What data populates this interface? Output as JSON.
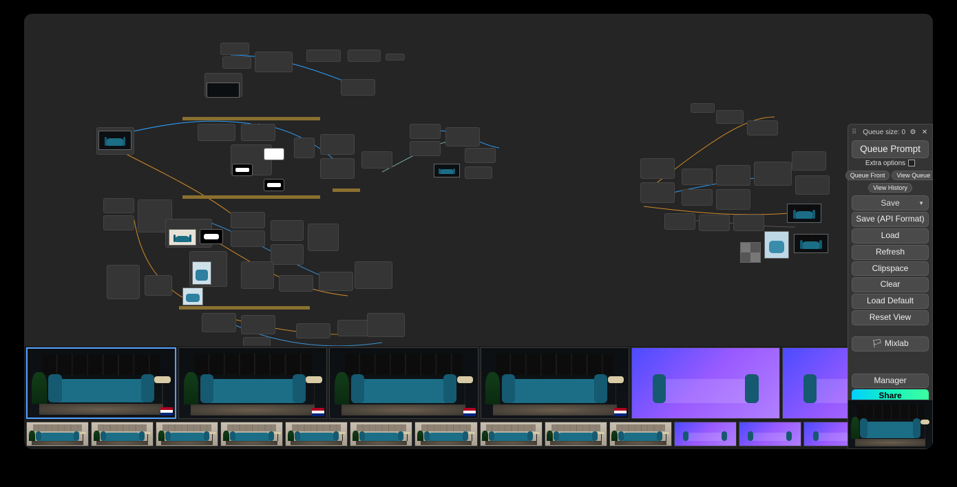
{
  "panel": {
    "queue_label": "Queue size:",
    "queue_value": "0",
    "queue_prompt": "Queue Prompt",
    "extra_options": "Extra options",
    "queue_front": "Queue Front",
    "view_queue": "View Queue",
    "view_history": "View History",
    "save_select": "Save",
    "save_api": "Save (API Format)",
    "load": "Load",
    "refresh": "Refresh",
    "clipspace": "Clipspace",
    "clear": "Clear",
    "load_default": "Load Default",
    "reset_view": "Reset View",
    "mixlab": "Mixlab",
    "manager": "Manager",
    "share": "Share"
  },
  "icons": {
    "gear": "⚙",
    "close": "✕",
    "caret": "▼",
    "drag": "⠿",
    "flag": "🏳"
  },
  "thumbnails": {
    "row1": [
      {
        "style": "dark",
        "selected": true
      },
      {
        "style": "dark"
      },
      {
        "style": "dark"
      },
      {
        "style": "dark"
      },
      {
        "style": "depth"
      },
      {
        "style": "depth"
      }
    ],
    "row2": [
      {
        "style": "light"
      },
      {
        "style": "light"
      },
      {
        "style": "light"
      },
      {
        "style": "light"
      },
      {
        "style": "light"
      },
      {
        "style": "light"
      },
      {
        "style": "light"
      },
      {
        "style": "light"
      },
      {
        "style": "light"
      },
      {
        "style": "light"
      },
      {
        "style": "depth"
      },
      {
        "style": "depth"
      },
      {
        "style": "depth"
      },
      {
        "style": "dark"
      }
    ]
  }
}
